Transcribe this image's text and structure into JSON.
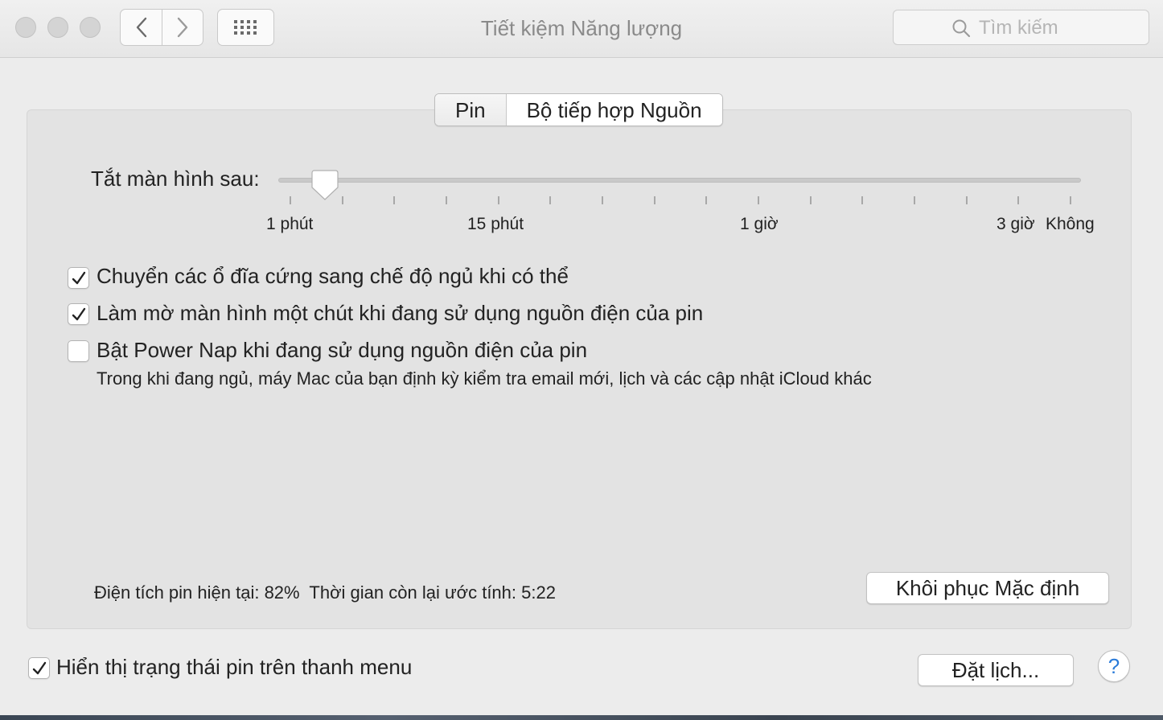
{
  "window": {
    "title": "Tiết kiệm Năng lượng",
    "search_placeholder": "Tìm kiếm"
  },
  "tabs": [
    {
      "label": "Pin",
      "selected": false
    },
    {
      "label": "Bộ tiếp hợp Nguồn",
      "selected": true
    }
  ],
  "display_sleep": {
    "label": "Tắt màn hình sau:",
    "value_fraction": 0.045,
    "tick_count": 16,
    "tick_labels": [
      "1 phút",
      "15 phút",
      "1 giờ",
      "3 giờ",
      "Không"
    ]
  },
  "options": [
    {
      "label": "Chuyển các ổ đĩa cứng sang chế độ ngủ khi có thể",
      "checked": true
    },
    {
      "label": "Làm mờ màn hình một chút khi đang sử dụng nguồn điện của pin",
      "checked": true
    },
    {
      "label": "Bật Power Nap khi đang sử dụng nguồn điện của pin",
      "checked": false
    }
  ],
  "power_nap_note": "Trong khi đang ngủ, máy Mac của bạn định kỳ kiểm tra email mới, lịch và các cập nhật iCloud khác",
  "battery_status": "Điện tích pin hiện tại: 82%  Thời gian còn lại ước tính: 5:22",
  "restore_defaults_label": "Khôi phục Mặc định",
  "show_battery_status": {
    "label": "Hiển thị trạng thái pin trên thanh menu",
    "checked": true
  },
  "schedule_label": "Đặt lịch...",
  "help_label": "?",
  "icons": [
    "back-arrow-icon",
    "forward-arrow-icon",
    "grid-icon",
    "search-icon",
    "checkmark-icon"
  ],
  "colors": {
    "accent": "#2a7bd9",
    "panel": "#e3e3e3",
    "background": "#ececec"
  }
}
